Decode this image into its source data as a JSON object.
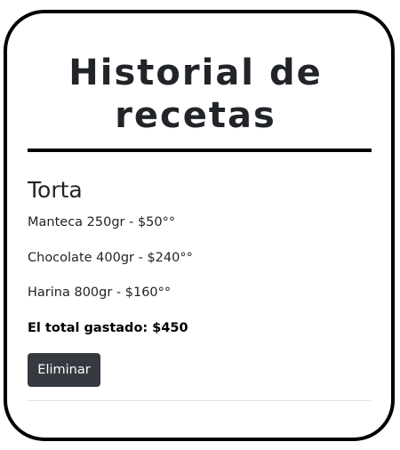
{
  "page": {
    "title": "Historial de recetas"
  },
  "recipe": {
    "name": "Torta",
    "ingredients": [
      "Manteca 250gr - $50°°",
      "Chocolate 400gr - $240°°",
      "Harina 800gr - $160°°"
    ],
    "total": "El total gastado: $450",
    "delete_label": "Eliminar"
  },
  "colors": {
    "card_border": "#000000",
    "button_bg": "#343a40",
    "button_text": "#ffffff",
    "text": "#212529"
  }
}
